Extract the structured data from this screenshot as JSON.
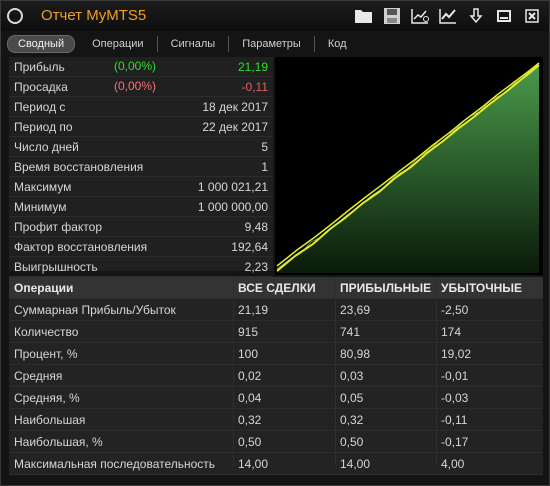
{
  "window": {
    "title": "Отчет MyMTS5",
    "icons": [
      "open-folder-icon",
      "save-icon",
      "chart-settings-icon",
      "chart-icon",
      "download-icon",
      "minimize-icon",
      "close-icon"
    ]
  },
  "tabs": [
    {
      "label": "Сводный",
      "active": true
    },
    {
      "label": "Операции",
      "active": false
    },
    {
      "label": "Сигналы",
      "active": false
    },
    {
      "label": "Параметры",
      "active": false
    },
    {
      "label": "Код",
      "active": false
    }
  ],
  "stats": [
    {
      "label": "Прибыль",
      "pct": "(0,00%)",
      "value": "21,19"
    },
    {
      "label": "Просадка",
      "pct": "(0,00%)",
      "value": "-0,11"
    },
    {
      "label": "Период с",
      "pct": "",
      "value": "18 дек 2017"
    },
    {
      "label": "Период по",
      "pct": "",
      "value": "22 дек 2017"
    },
    {
      "label": "Число дней",
      "pct": "",
      "value": "5"
    },
    {
      "label": "Время восстановления",
      "pct": "",
      "value": "1"
    },
    {
      "label": "Максимум",
      "pct": "",
      "value": "1 000 021,21"
    },
    {
      "label": "Минимум",
      "pct": "",
      "value": "1 000 000,00"
    },
    {
      "label": "Профит фактор",
      "pct": "",
      "value": "9,48"
    },
    {
      "label": "Фактор восстановления",
      "pct": "",
      "value": "192,64"
    },
    {
      "label": "Выигрышность",
      "pct": "",
      "value": "2,23"
    }
  ],
  "colors": {
    "accent": "#f0a020",
    "profit": "#2ee02e",
    "loss": "#ff7070",
    "line": "#e6f020",
    "area": "#3a7a3a"
  },
  "table": {
    "headers": [
      "Операции",
      "ВСЕ СДЕЛКИ",
      "ПРИБЫЛЬНЫЕ",
      "УБЫТОЧНЫЕ"
    ],
    "rows": [
      [
        "Суммарная Прибыль/Убыток",
        "21,19",
        "23,69",
        "-2,50"
      ],
      [
        "Количество",
        "915",
        "741",
        "174"
      ],
      [
        "Процент, %",
        "100",
        "80,98",
        "19,02"
      ],
      [
        "Средняя",
        "0,02",
        "0,03",
        "-0,01"
      ],
      [
        "Средняя, %",
        "0,04",
        "0,05",
        "-0,03"
      ],
      [
        "Наибольшая",
        "0,32",
        "0,32",
        "-0,11"
      ],
      [
        "Наибольшая, %",
        "0,50",
        "0,50",
        "-0,17"
      ],
      [
        "Максимальная последовательность",
        "14,00",
        "14,00",
        "4,00"
      ]
    ]
  }
}
